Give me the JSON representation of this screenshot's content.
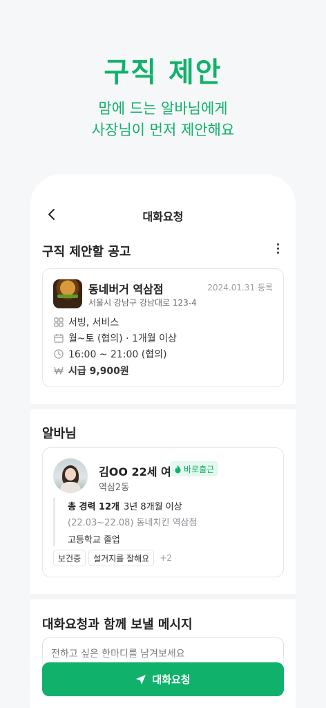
{
  "hero": {
    "title": "구직 제안",
    "subtitle_line1": "맘에 드는 알바님에게",
    "subtitle_line2": "사장님이 먼저 제안해요"
  },
  "topbar": {
    "title": "대화요청"
  },
  "job_section": {
    "title": "구직 제안할 공고"
  },
  "job": {
    "store_name": "동네버거 역삼점",
    "date": "2024.01.31 등록",
    "address": "서울시 강남구 강남대로 123-4",
    "category": "서빙, 서비스",
    "schedule": "월~토 (협의) · 1개월 이상",
    "hours": "16:00 ~ 21:00 (협의)",
    "wage": "시급 9,900원"
  },
  "candidate_section": {
    "title": "알바님"
  },
  "candidate": {
    "name": "김OO 22세 여",
    "badge": "바로출근",
    "location": "역삼2동",
    "career_total": "총 경력 12개",
    "career_duration": "3년 8개월 이상",
    "career_detail": "(22.03~22.08) 동네치킨 역삼점",
    "education": "고등학교 졸업",
    "tags": [
      "보건증",
      "설거지를 잘해요"
    ],
    "tags_more": "+2"
  },
  "message_section": {
    "title": "대화요청과 함께 보낼 메시지",
    "placeholder": "전하고 싶은 한마디를 남겨보세요"
  },
  "cta": {
    "label": "대화요청"
  },
  "colors": {
    "brand": "#10b16a",
    "badge_bg": "#e5f7ee"
  }
}
